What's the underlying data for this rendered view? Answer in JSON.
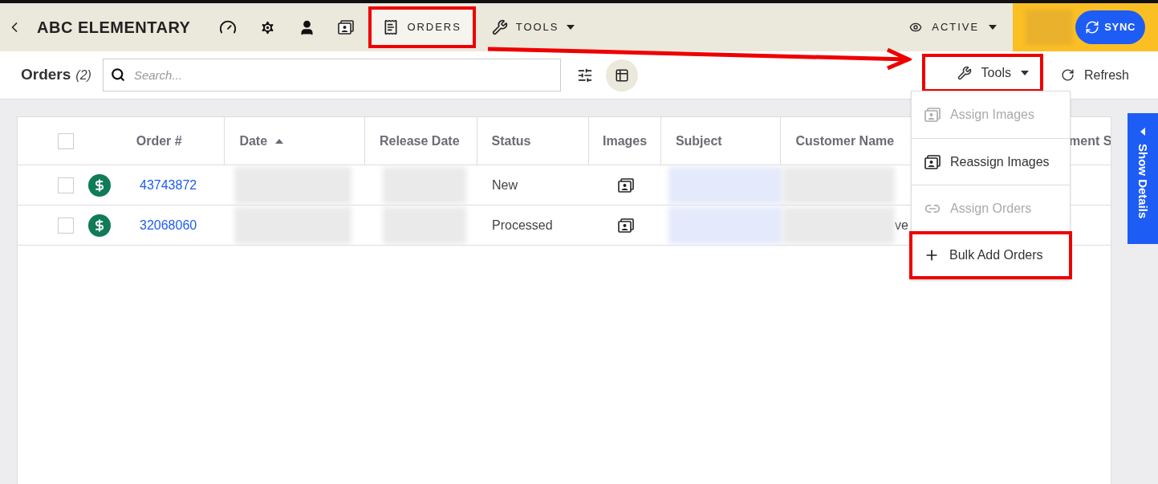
{
  "header": {
    "title": "ABC ELEMENTARY",
    "tabs": [
      {
        "label": "ORDERS",
        "kind": "page",
        "selected": true
      },
      {
        "label": "TOOLS",
        "kind": "dropdown",
        "selected": false
      }
    ],
    "filter": "ACTIVE",
    "sync": "SYNC"
  },
  "toolbar": {
    "title": "Orders",
    "count": "(2)",
    "search": {
      "placeholder": "Search..."
    },
    "tools": "Tools",
    "refresh": "Refresh"
  },
  "table": {
    "all_checked": false,
    "columns": [
      {
        "label": "Order #",
        "sorted": false
      },
      {
        "label": "Date",
        "sorted": true
      },
      {
        "label": "Release Date",
        "sorted": false
      },
      {
        "label": "Status",
        "sorted": false
      },
      {
        "label": "Images",
        "sorted": false
      },
      {
        "label": "Subject",
        "sorted": false
      },
      {
        "label": "Customer Name",
        "sorted": false
      },
      {
        "label": "ment S",
        "sorted": false
      }
    ],
    "rows": [
      {
        "checked": false,
        "order": "43743872",
        "status": "New",
        "customer_tail": ""
      },
      {
        "checked": false,
        "order": "32068060",
        "status": "Processed",
        "customer_tail": "ve"
      }
    ]
  },
  "tools_menu": [
    {
      "label": "Assign Images",
      "kind": "images",
      "disabled": true
    },
    {
      "label": "Reassign Images",
      "kind": "images",
      "disabled": false
    },
    {
      "label": "Assign Orders",
      "kind": "link",
      "disabled": true
    },
    {
      "label": "Bulk Add Orders",
      "kind": "add",
      "disabled": false
    }
  ],
  "side_tab": "Show Details"
}
